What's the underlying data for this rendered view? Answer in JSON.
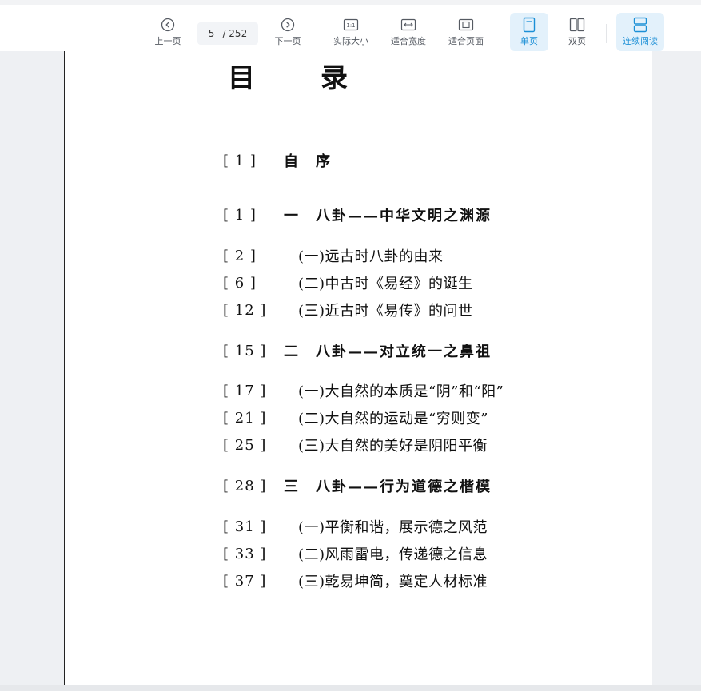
{
  "toolbar": {
    "prev_label": "上一页",
    "current_page": "5",
    "total_pages": "/ 252",
    "next_label": "下一页",
    "actual_size_label": "实际大小",
    "fit_width_label": "适合宽度",
    "fit_page_label": "适合页面",
    "single_page_label": "单页",
    "double_page_label": "双页",
    "continuous_label": "连续阅读",
    "accent_color": "#1b8fd6"
  },
  "document": {
    "title": "目录",
    "entries": [
      {
        "page": "[ 1 ]",
        "text": "自　序",
        "level": "chapter"
      },
      {
        "page": "[ 1 ]",
        "text": "一　八卦——中华文明之渊源",
        "level": "chapter"
      },
      {
        "page": "[ 2 ]",
        "text": "(一)远古时八卦的由来",
        "level": "section"
      },
      {
        "page": "[ 6 ]",
        "text": "(二)中古时《易经》的诞生",
        "level": "section"
      },
      {
        "page": "[ 12 ]",
        "text": "(三)近古时《易传》的问世",
        "level": "section"
      },
      {
        "page": "[ 15 ]",
        "text": "二　八卦——对立统一之鼻祖",
        "level": "chapter"
      },
      {
        "page": "[ 17 ]",
        "text": "(一)大自然的本质是“阴”和“阳”",
        "level": "section"
      },
      {
        "page": "[ 21 ]",
        "text": "(二)大自然的运动是“穷则变”",
        "level": "section"
      },
      {
        "page": "[ 25 ]",
        "text": "(三)大自然的美好是阴阳平衡",
        "level": "section"
      },
      {
        "page": "[ 28 ]",
        "text": "三　八卦——行为道德之楷模",
        "level": "chapter"
      },
      {
        "page": "[ 31 ]",
        "text": "(一)平衡和谐，展示德之风范",
        "level": "section"
      },
      {
        "page": "[ 33 ]",
        "text": "(二)风雨雷电，传递德之信息",
        "level": "section"
      },
      {
        "page": "[ 37 ]",
        "text": "(三)乾易坤简，奠定人材标准",
        "level": "section"
      }
    ]
  }
}
